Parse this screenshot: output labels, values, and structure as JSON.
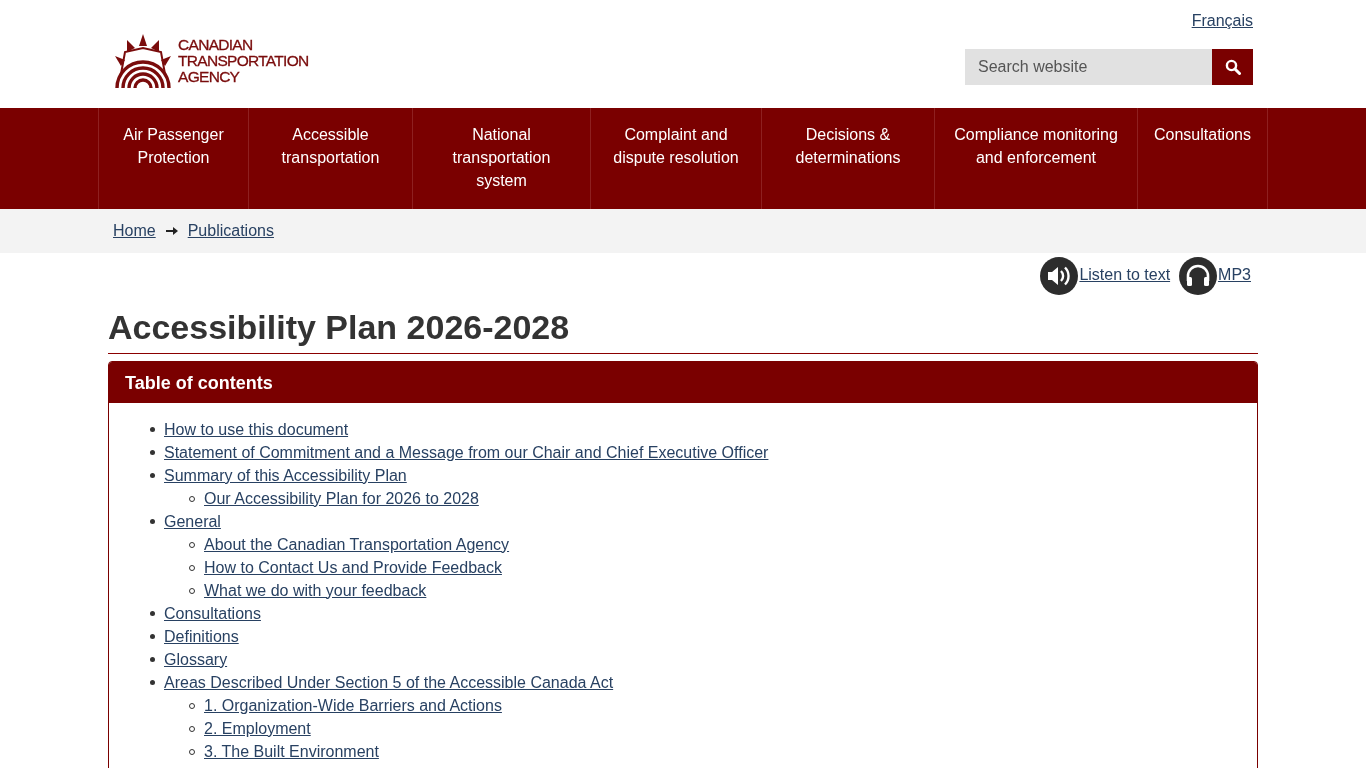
{
  "header": {
    "logo_lines": [
      "CANADIAN",
      "TRANSPORTATION",
      "AGENCY"
    ],
    "language_link": "Français",
    "search": {
      "placeholder": "Search website"
    }
  },
  "nav": {
    "items": [
      {
        "lines": [
          "Air Passenger",
          "Protection"
        ]
      },
      {
        "lines": [
          "Accessible",
          "transportation"
        ]
      },
      {
        "lines": [
          "National",
          "transportation",
          "system"
        ]
      },
      {
        "lines": [
          "Complaint and",
          "dispute resolution"
        ]
      },
      {
        "lines": [
          "Decisions &",
          "determinations"
        ]
      },
      {
        "lines": [
          "Compliance monitoring",
          "and enforcement"
        ]
      },
      {
        "lines": [
          "Consultations"
        ]
      }
    ]
  },
  "breadcrumb": [
    {
      "label": "Home"
    },
    {
      "label": "Publications"
    }
  ],
  "audio_links": [
    {
      "kind": "listen",
      "label": "Listen to text"
    },
    {
      "kind": "mp3",
      "label": "MP3"
    }
  ],
  "page_title": "Accessibility Plan 2026-2028",
  "table_of_contents": {
    "title": "Table of contents",
    "items": [
      {
        "label": "How to use this document"
      },
      {
        "label": "Statement of Commitment and a Message from our Chair and Chief Executive Officer"
      },
      {
        "label": "Summary of this Accessibility Plan",
        "children": [
          {
            "label": "Our Accessibility Plan for 2026 to 2028"
          }
        ]
      },
      {
        "label": "General",
        "children": [
          {
            "label": "About the Canadian Transportation Agency"
          },
          {
            "label": "How to Contact Us and Provide Feedback"
          },
          {
            "label": "What we do with your feedback"
          }
        ]
      },
      {
        "label": "Consultations"
      },
      {
        "label": "Definitions"
      },
      {
        "label": "Glossary"
      },
      {
        "label": "Areas Described Under Section 5 of the Accessible Canada Act",
        "children": [
          {
            "label": "1. Organization-Wide Barriers and Actions"
          },
          {
            "label": "2. Employment"
          },
          {
            "label": "3. The Built Environment"
          }
        ]
      }
    ]
  }
}
